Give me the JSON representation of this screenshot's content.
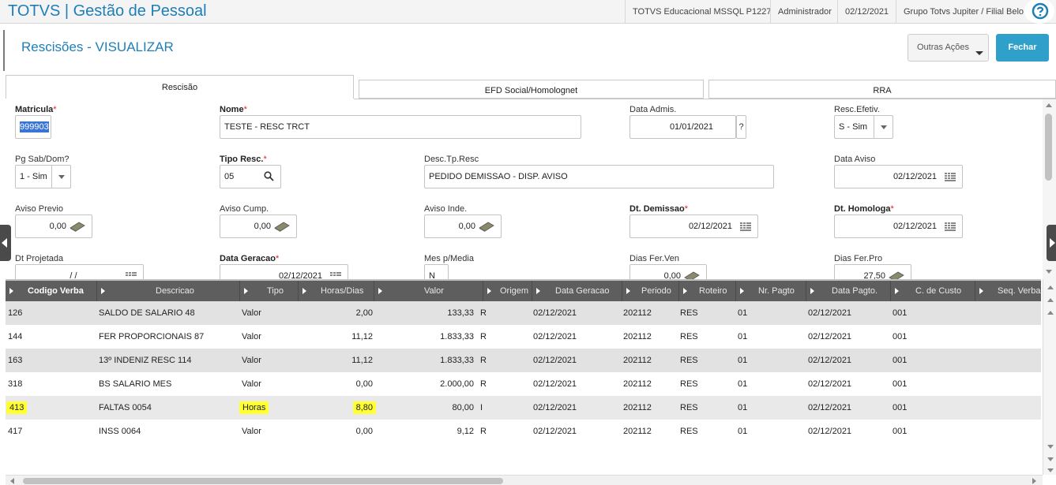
{
  "app": {
    "title": "TOTVS | Gestão de Pessoal",
    "environment": "TOTVS Educacional MSSQL P1227",
    "user": "Administrador",
    "date": "02/12/2021",
    "company": "Grupo Totvs Jupiter / Filial Belo H"
  },
  "page": {
    "title": "Rescisões - VISUALIZAR",
    "actions": {
      "more_label": "Outras Ações",
      "close_label": "Fechar"
    }
  },
  "tabs": [
    {
      "label": "Rescisão",
      "active": true
    },
    {
      "label": "EFD Social/Homolognet",
      "active": false
    },
    {
      "label": "RRA",
      "active": false
    }
  ],
  "form": {
    "matricula": {
      "label": "Matricula",
      "required": "*",
      "value": "999903"
    },
    "nome": {
      "label": "Nome",
      "required": "*",
      "value": "TESTE - RESC TRCT"
    },
    "data_admis": {
      "label": "Data Admis.",
      "value": "01/01/2021",
      "help": "?"
    },
    "resc_efetiv": {
      "label": "Resc.Efetiv.",
      "value": "S - Sim"
    },
    "pg_sab_dom": {
      "label": "Pg Sab/Dom?",
      "value": "1 - Sim"
    },
    "tipo_resc": {
      "label": "Tipo Resc.",
      "required": "*",
      "value": "05"
    },
    "desc_tp_resc": {
      "label": "Desc.Tp.Resc",
      "value": "PEDIDO DEMISSAO - DISP. AVISO"
    },
    "data_aviso": {
      "label": "Data Aviso",
      "value": "02/12/2021"
    },
    "aviso_previo": {
      "label": "Aviso Previo",
      "value": "0,00"
    },
    "aviso_cump": {
      "label": "Aviso Cump.",
      "value": "0,00"
    },
    "aviso_inde": {
      "label": "Aviso Inde.",
      "value": "0,00"
    },
    "dt_demissao": {
      "label": "Dt. Demissao",
      "required": "*",
      "value": "02/12/2021"
    },
    "dt_homologa": {
      "label": "Dt. Homologa",
      "required": "*",
      "value": "02/12/2021"
    },
    "dt_projetada": {
      "label": "Dt Projetada",
      "value": "/ /"
    },
    "data_geracao": {
      "label": "Data Geracao",
      "required": "*",
      "value": "02/12/2021"
    },
    "mes_p_media": {
      "label": "Mes p/Media",
      "value": "N"
    },
    "dias_fer_ven": {
      "label": "Dias Fer.Ven",
      "value": "0,00"
    },
    "dias_fer_pro": {
      "label": "Dias Fer.Pro",
      "value": "27,50"
    }
  },
  "grid": {
    "columns": [
      "Codigo Verba",
      "Descricao",
      "Tipo",
      "Horas/Dias",
      "Valor",
      "Origem",
      "Data Geracao",
      "Periodo",
      "Roteiro",
      "Nr. Pagto",
      "Data Pagto.",
      "C. de Custo",
      "Seq. Verba"
    ],
    "rows": [
      {
        "codigo": "126",
        "descricao": "SALDO DE SALARIO 48",
        "tipo": "Valor",
        "horas": "2,00",
        "valor": "133,33",
        "origem": "R",
        "data_geracao": "02/12/2021",
        "periodo": "202112",
        "roteiro": "RES",
        "nr_pagto": "01",
        "data_pagto": "02/12/2021",
        "custo": "001"
      },
      {
        "codigo": "144",
        "descricao": "FER PROPORCIONAIS 87",
        "tipo": "Valor",
        "horas": "11,12",
        "valor": "1.833,33",
        "origem": "R",
        "data_geracao": "02/12/2021",
        "periodo": "202112",
        "roteiro": "RES",
        "nr_pagto": "01",
        "data_pagto": "02/12/2021",
        "custo": "001"
      },
      {
        "codigo": "163",
        "descricao": "13º INDENIZ RESC 114",
        "tipo": "Valor",
        "horas": "11,12",
        "valor": "1.833,33",
        "origem": "R",
        "data_geracao": "02/12/2021",
        "periodo": "202112",
        "roteiro": "RES",
        "nr_pagto": "01",
        "data_pagto": "02/12/2021",
        "custo": "001"
      },
      {
        "codigo": "318",
        "descricao": "BS SALARIO MES",
        "tipo": "Valor",
        "horas": "0,00",
        "valor": "2.000,00",
        "origem": "R",
        "data_geracao": "02/12/2021",
        "periodo": "202112",
        "roteiro": "RES",
        "nr_pagto": "01",
        "data_pagto": "02/12/2021",
        "custo": "001"
      },
      {
        "codigo": "413",
        "descricao": "FALTAS 0054",
        "tipo": "Horas",
        "horas": "8,80",
        "valor": "80,00",
        "origem": "I",
        "data_geracao": "02/12/2021",
        "periodo": "202112",
        "roteiro": "RES",
        "nr_pagto": "01",
        "data_pagto": "02/12/2021",
        "custo": "001"
      },
      {
        "codigo": "417",
        "descricao": "INSS 0064",
        "tipo": "Valor",
        "horas": "0,00",
        "valor": "9,12",
        "origem": "R",
        "data_geracao": "02/12/2021",
        "periodo": "202112",
        "roteiro": "RES",
        "nr_pagto": "01",
        "data_pagto": "02/12/2021",
        "custo": "001"
      }
    ]
  },
  "colors": {
    "brand": "#1e7fb8",
    "primary_button": "#2fa0c9",
    "grid_header": "#5e5e5e",
    "highlight": "#ffff33",
    "required": "#e02020"
  },
  "icons": [
    "help-icon",
    "search-icon",
    "calendar-icon",
    "money-icon",
    "chevron-down-icon"
  ]
}
